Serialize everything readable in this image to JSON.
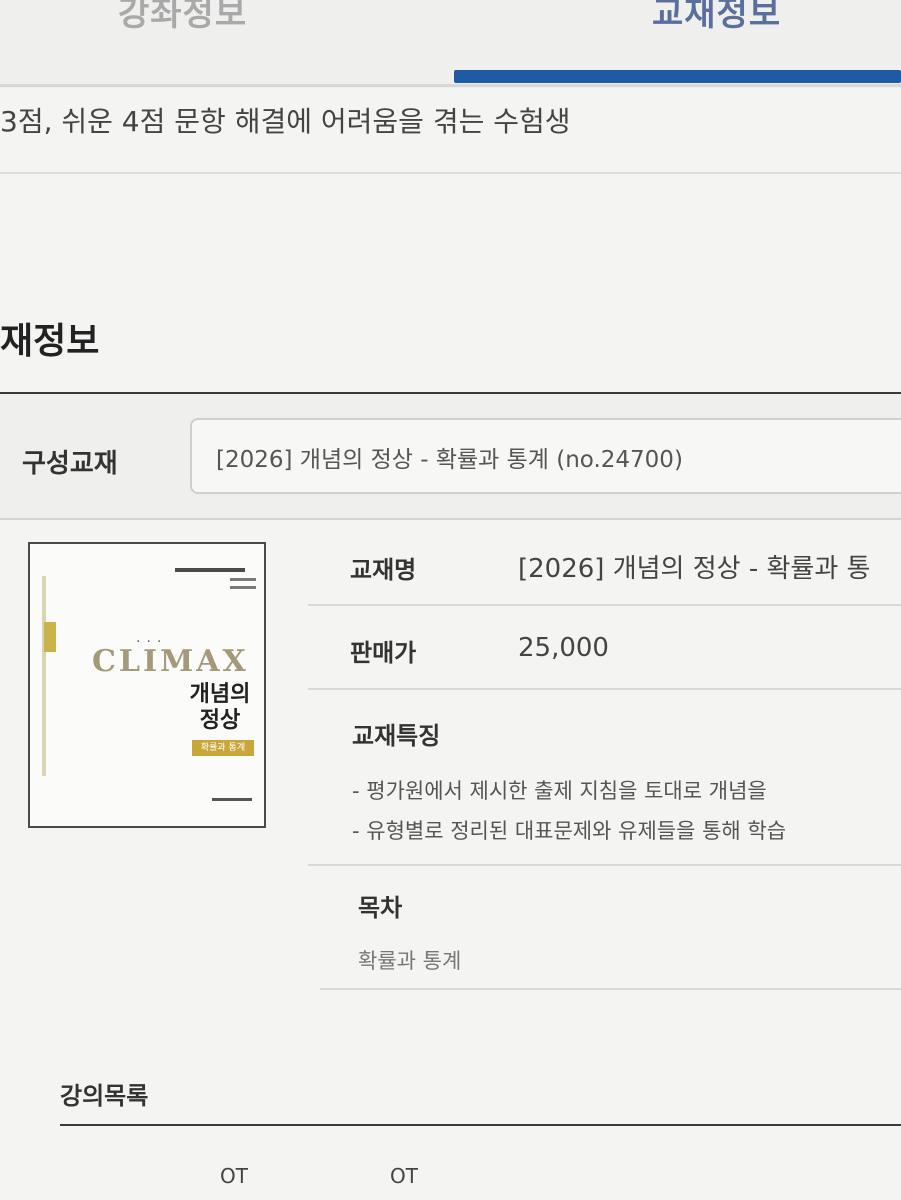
{
  "tabs": {
    "lecture_info": "강좌정보",
    "book_info": "교재정보"
  },
  "target": {
    "text": "3점, 쉬운 4점 문항 해결에 어려움을 겪는 수험생"
  },
  "section": {
    "title": "재정보"
  },
  "composition": {
    "label": "구성교재",
    "selected": "[2026] 개념의 정상 - 확률과 통계 (no.24700)"
  },
  "book_cover": {
    "brand": "CLIMAX",
    "title_line1": "개념의",
    "title_line2": "정상",
    "subtitle": "확률과 통계"
  },
  "details": {
    "name_label": "교재명",
    "name_value": "[2026] 개념의 정상 - 확률과 통",
    "price_label": "판매가",
    "price_value": "25,000",
    "features_label": "교재특징",
    "features": [
      "- 평가원에서 제시한 출제 지침을 토대로 개념을",
      "- 유형별로 정리된 대표문제와 유제들을 통해 학습"
    ],
    "toc_label": "목차",
    "toc_items": [
      "확률과 통계"
    ]
  },
  "lectures": {
    "title": "강의목록",
    "items": [
      "OT",
      "OT"
    ]
  },
  "colors": {
    "accent": "#1f5aa6",
    "background": "#f4f4f2"
  }
}
